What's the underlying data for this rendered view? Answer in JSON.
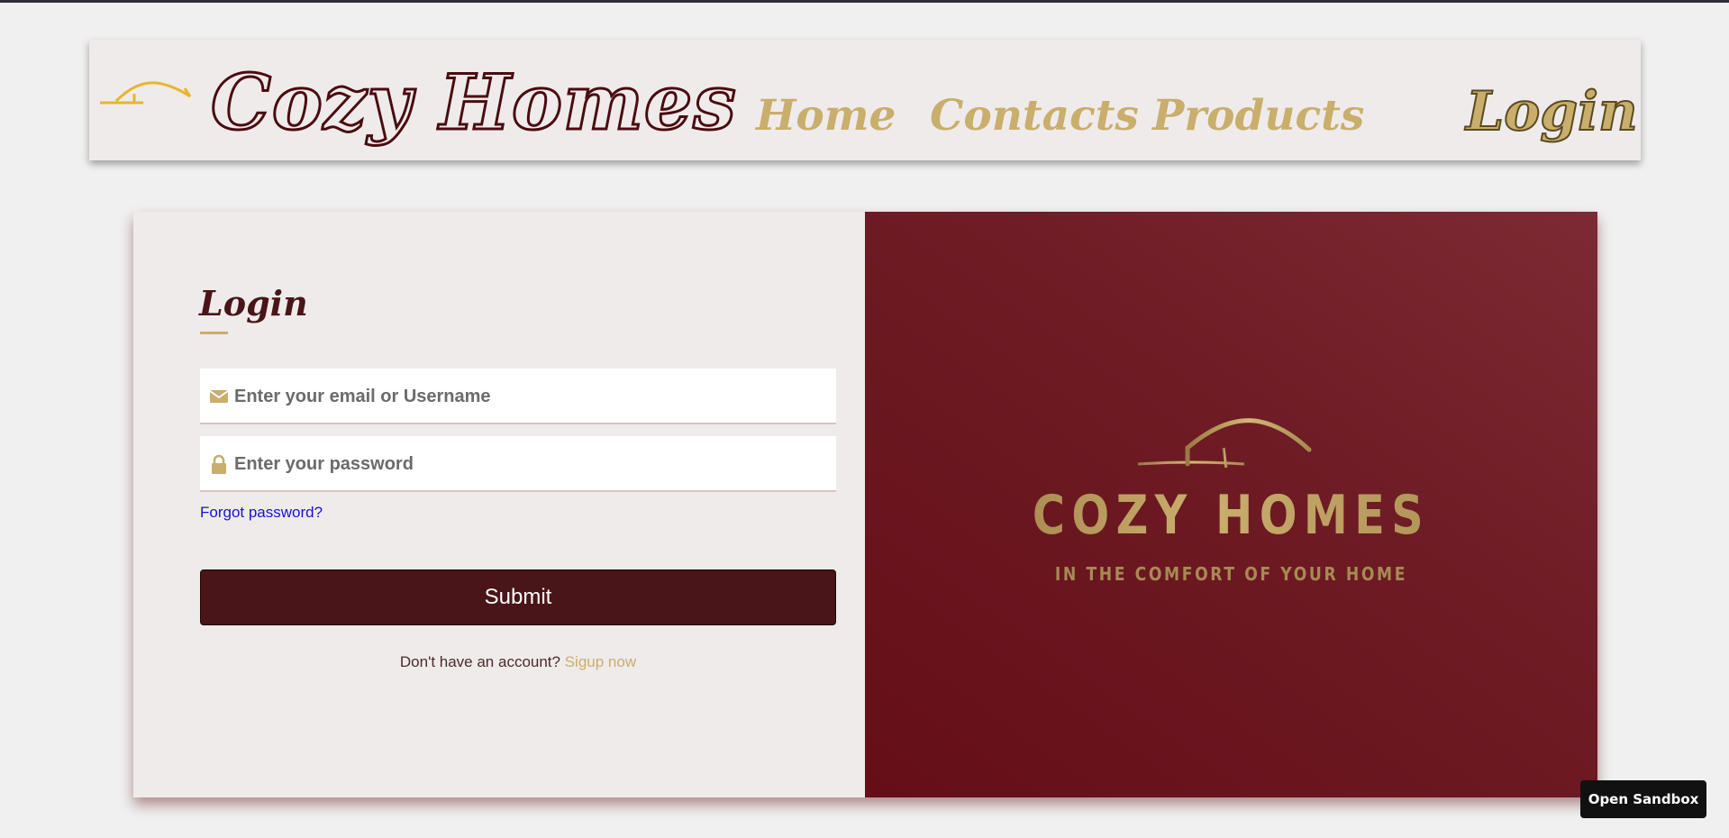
{
  "header": {
    "brand": "Cozy Homes",
    "nav": {
      "home": "Home",
      "contacts": "Contacts",
      "products": "Products"
    },
    "login": "Login"
  },
  "form": {
    "title": "Login",
    "email_placeholder": "Enter your email or Username",
    "password_placeholder": "Enter your password",
    "forgot": "Forgot password?",
    "submit": "Submit",
    "no_account": "Don't have an account?",
    "signup": "Sigup now"
  },
  "panel": {
    "brand": "COZY HOMES",
    "tagline": "IN THE COMFORT OF YOUR HOME"
  },
  "sandbox": {
    "label": "Open Sandbox"
  },
  "icons": {
    "email": "envelope-icon",
    "password": "lock-icon",
    "logo": "house-roof-logo"
  },
  "colors": {
    "gold": "#c9ae6c",
    "maroon": "#4a1518",
    "panel_red": "#6e1c25",
    "link_blue": "#1a12d6",
    "background": "#f1f0f0"
  }
}
